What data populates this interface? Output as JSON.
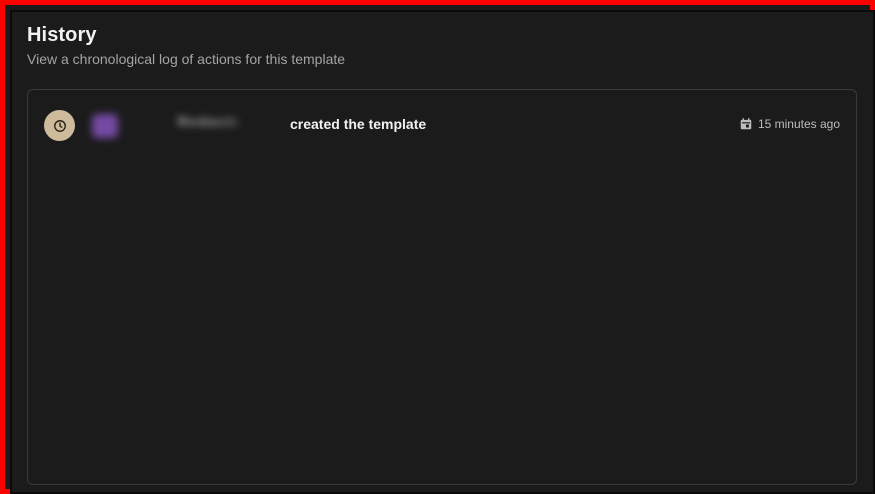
{
  "header": {
    "title": "History",
    "subtitle": "View a chronological log of actions for this template"
  },
  "history": {
    "entries": [
      {
        "icon": "clock-icon",
        "user_name": "Redacted",
        "action": "created the template",
        "time_icon": "calendar-icon",
        "time": "15 minutes ago"
      }
    ]
  },
  "colors": {
    "background": "#1b1b1b",
    "border": "#3a3a3a",
    "badge": "#cdbb9c",
    "avatar": "#7e4fb3",
    "frame": "#ff0000"
  }
}
